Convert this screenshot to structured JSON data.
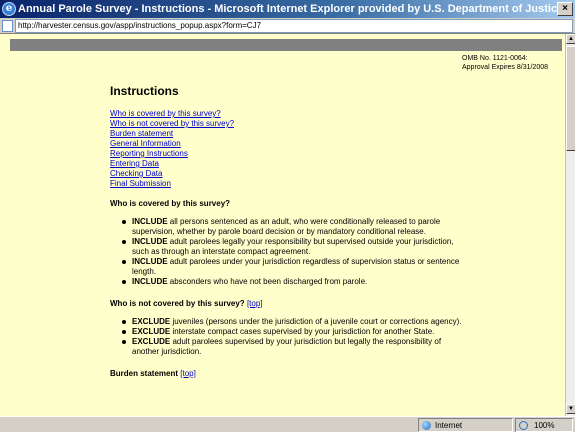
{
  "window": {
    "title": "Annual Parole Survey - Instructions - Microsoft Internet Explorer provided by U.S. Department of Justice",
    "close_label": "×"
  },
  "address": {
    "url": "http://harvester.census.gov/aspp/instructions_popup.aspx?form=CJ7"
  },
  "page": {
    "omb_line1": "OMB No. 1121-0064:",
    "omb_line2": "Approval Expires 8/31/2008",
    "heading": "Instructions",
    "toc": [
      "Who is covered by this survey?",
      "Who is not covered by this survey?",
      "Burden statement",
      "General Information",
      "Reporting Instructions",
      "Entering Data",
      "Checking Data",
      "Final Submission"
    ],
    "covered": {
      "title": "Who is covered by this survey?",
      "items": [
        {
          "kw": "INCLUDE",
          "text": " all persons sentenced as an adult, who were conditionally released to parole supervision, whether by parole board decision or by mandatory conditional release."
        },
        {
          "kw": "INCLUDE",
          "text": " adult parolees legally your responsibility but supervised outside your jurisdiction, such as through an interstate compact agreement."
        },
        {
          "kw": "INCLUDE",
          "text": " adult parolees under your jurisdiction regardless of supervision status or sentence length."
        },
        {
          "kw": "INCLUDE",
          "text": " absconders who have not been discharged from parole."
        }
      ]
    },
    "not_covered": {
      "title": "Who is not covered by this survey?",
      "top_link": "[top]",
      "items": [
        {
          "kw": "EXCLUDE",
          "text": " juveniles (persons under the jurisdiction of a juvenile court or corrections agency)."
        },
        {
          "kw": "EXCLUDE",
          "text": " interstate compact cases supervised by your jurisdiction for another State."
        },
        {
          "kw": "EXCLUDE",
          "text": " adult parolees supervised by your jurisdiction but legally the responsibility of another jurisdiction."
        }
      ]
    },
    "burden": {
      "title": "Burden statement",
      "top_link": "[top]"
    }
  },
  "status": {
    "zone": "Internet",
    "zoom": "100%"
  }
}
